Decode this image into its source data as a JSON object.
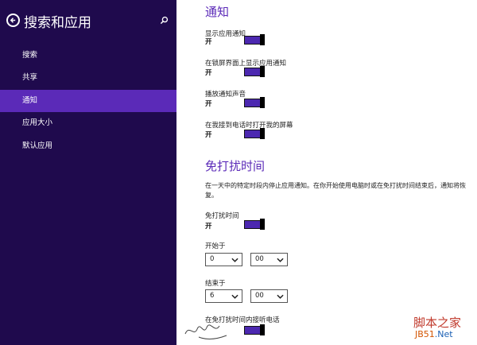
{
  "sidebar": {
    "title": "搜索和应用",
    "items": [
      {
        "label": "搜索"
      },
      {
        "label": "共享"
      },
      {
        "label": "通知"
      },
      {
        "label": "应用大小"
      },
      {
        "label": "默认应用"
      }
    ],
    "active_index": 2
  },
  "notifications": {
    "heading": "通知",
    "settings": [
      {
        "label": "显示应用通知",
        "state": "开"
      },
      {
        "label": "在锁屏界面上显示应用通知",
        "state": "开"
      },
      {
        "label": "播放通知声音",
        "state": "开"
      },
      {
        "label": "在我接到电话时打开我的屏幕",
        "state": "开"
      }
    ]
  },
  "quiet_hours": {
    "heading": "免打扰时间",
    "description": "在一天中的特定时段内停止应用通知。在你开始使用电脑时或在免打扰时间结束后，通知将恢复。",
    "toggle": {
      "label": "免打扰时间",
      "state": "开"
    },
    "start": {
      "label": "开始于",
      "hour": "0",
      "minute": "00"
    },
    "end": {
      "label": "结束于",
      "hour": "6",
      "minute": "00"
    },
    "calls": {
      "label": "在免打扰时间内接听电话"
    }
  },
  "watermark": {
    "logo": "脚本之家",
    "url_a": "JB51",
    "url_b": ".Net"
  },
  "colors": {
    "sidebar_bg": "#1f0a4d",
    "accent": "#5b2ab8",
    "toggle_fill": "#4c28b0"
  }
}
